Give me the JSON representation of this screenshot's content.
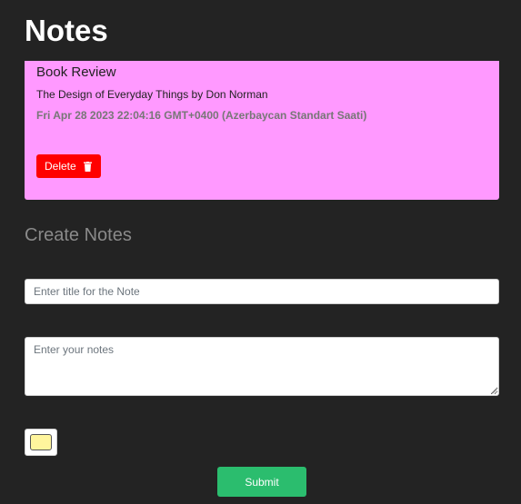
{
  "header": {
    "title": "Notes"
  },
  "notes": [
    {
      "title": "Book Review",
      "body": "The Design of Everyday Things by Don Norman",
      "date": "Fri Apr 28 2023 22:04:16 GMT+0400 (Azerbaycan Standart Saati)",
      "color": "#ff99ff",
      "delete_label": "Delete",
      "delete_icon": "trash-icon"
    }
  ],
  "create_form": {
    "section_title": "Create Notes",
    "title_placeholder": "Enter title for the Note",
    "title_value": "",
    "notes_placeholder": "Enter your notes",
    "notes_value": "",
    "selected_color": "#fff59d",
    "submit_label": "Submit"
  },
  "colors": {
    "background": "#232323",
    "delete": "#ff0000",
    "submit": "#2bbd6e"
  }
}
